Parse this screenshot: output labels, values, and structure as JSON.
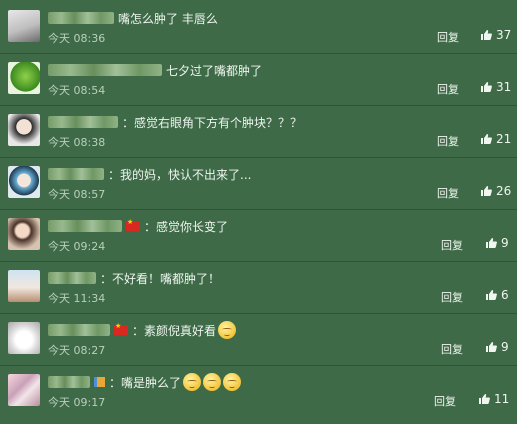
{
  "comments": [
    {
      "text": "嘴怎么肿了 丰唇么",
      "time": "今天 08:36",
      "reply": "回复",
      "likes": "37"
    },
    {
      "text": "七夕过了嘴都肿了",
      "time": "今天 08:54",
      "reply": "回复",
      "likes": "31"
    },
    {
      "text": "：感觉右眼角下方有个肿块？？？",
      "time": "今天 08:38",
      "reply": "回复",
      "likes": "21"
    },
    {
      "text": "：我的妈，快认不出来了...",
      "time": "今天 08:57",
      "reply": "回复",
      "likes": "26"
    },
    {
      "text": "：感觉你长变了",
      "time": "今天 09:24",
      "reply": "回复",
      "likes": "9"
    },
    {
      "text": "：不好看！嘴都肿了！",
      "time": "今天 11:34",
      "reply": "回复",
      "likes": "6"
    },
    {
      "text": "：素颜倪真好看",
      "time": "今天 08:27",
      "reply": "回复",
      "likes": "9"
    },
    {
      "text": "：嘴是肿么了",
      "time": "今天 09:17",
      "reply": "回复",
      "likes": "11"
    }
  ]
}
